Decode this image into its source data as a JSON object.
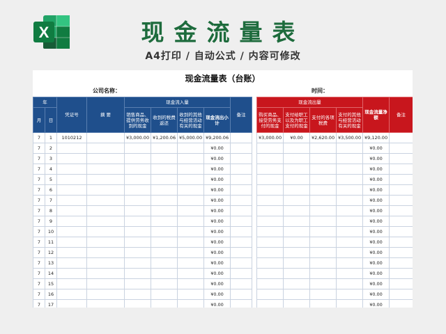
{
  "banner": {
    "logo_letter": "X",
    "title": "现金流量表",
    "subtitle": "A4打印 / 自动公式 / 内容可修改"
  },
  "sheet": {
    "title": "现金流量表（台账）",
    "company_label": "公司名称：",
    "time_label": "时间："
  },
  "headers": {
    "year": "年",
    "month": "月",
    "day": "日",
    "voucher": "凭证号",
    "summary": "摘    要",
    "inflow_group": "现金流入量",
    "inflow_cols": [
      "销售商品、提供劳务收到的现金",
      "收到的税费返还",
      "收到的其他与经营活动有关的现金",
      "现金流出小计"
    ],
    "remark": "备注",
    "outflow_group": "现金流出量",
    "outflow_cols": [
      "购买商品、接受劳务支付的现金",
      "支付给职工以及为职工支付的现金",
      "支付的各项税费",
      "支付的其他与经营活动有关的现金"
    ],
    "net_flow": "现金流量净额",
    "remark2": "备注"
  },
  "rows": [
    {
      "m": "7",
      "d": "1",
      "voucher": "1010212",
      "in1": "¥3,000.00",
      "in2": "¥1,200.06",
      "in3": "¥5,000.00",
      "in_sub": "¥9,200.06",
      "out1": "¥3,000.00",
      "out2": "¥0.00",
      "out3": "¥2,620.00",
      "out4": "¥3,500.00",
      "net": "¥9,120.00"
    },
    {
      "m": "7",
      "d": "2",
      "voucher": "",
      "in1": "",
      "in2": "",
      "in3": "",
      "in_sub": "¥0.00",
      "out1": "",
      "out2": "",
      "out3": "",
      "out4": "",
      "net": "¥0.00"
    },
    {
      "m": "7",
      "d": "3",
      "voucher": "",
      "in1": "",
      "in2": "",
      "in3": "",
      "in_sub": "¥0.00",
      "out1": "",
      "out2": "",
      "out3": "",
      "out4": "",
      "net": "¥0.00"
    },
    {
      "m": "7",
      "d": "4",
      "voucher": "",
      "in1": "",
      "in2": "",
      "in3": "",
      "in_sub": "¥0.00",
      "out1": "",
      "out2": "",
      "out3": "",
      "out4": "",
      "net": "¥0.00"
    },
    {
      "m": "7",
      "d": "5",
      "voucher": "",
      "in1": "",
      "in2": "",
      "in3": "",
      "in_sub": "¥0.00",
      "out1": "",
      "out2": "",
      "out3": "",
      "out4": "",
      "net": "¥0.00"
    },
    {
      "m": "7",
      "d": "6",
      "voucher": "",
      "in1": "",
      "in2": "",
      "in3": "",
      "in_sub": "¥0.00",
      "out1": "",
      "out2": "",
      "out3": "",
      "out4": "",
      "net": "¥0.00"
    },
    {
      "m": "7",
      "d": "7",
      "voucher": "",
      "in1": "",
      "in2": "",
      "in3": "",
      "in_sub": "¥0.00",
      "out1": "",
      "out2": "",
      "out3": "",
      "out4": "",
      "net": "¥0.00"
    },
    {
      "m": "7",
      "d": "8",
      "voucher": "",
      "in1": "",
      "in2": "",
      "in3": "",
      "in_sub": "¥0.00",
      "out1": "",
      "out2": "",
      "out3": "",
      "out4": "",
      "net": "¥0.00"
    },
    {
      "m": "7",
      "d": "9",
      "voucher": "",
      "in1": "",
      "in2": "",
      "in3": "",
      "in_sub": "¥0.00",
      "out1": "",
      "out2": "",
      "out3": "",
      "out4": "",
      "net": "¥0.00"
    },
    {
      "m": "7",
      "d": "10",
      "voucher": "",
      "in1": "",
      "in2": "",
      "in3": "",
      "in_sub": "¥0.00",
      "out1": "",
      "out2": "",
      "out3": "",
      "out4": "",
      "net": "¥0.00"
    },
    {
      "m": "7",
      "d": "11",
      "voucher": "",
      "in1": "",
      "in2": "",
      "in3": "",
      "in_sub": "¥0.00",
      "out1": "",
      "out2": "",
      "out3": "",
      "out4": "",
      "net": "¥0.00"
    },
    {
      "m": "7",
      "d": "12",
      "voucher": "",
      "in1": "",
      "in2": "",
      "in3": "",
      "in_sub": "¥0.00",
      "out1": "",
      "out2": "",
      "out3": "",
      "out4": "",
      "net": "¥0.00"
    },
    {
      "m": "7",
      "d": "13",
      "voucher": "",
      "in1": "",
      "in2": "",
      "in3": "",
      "in_sub": "¥0.00",
      "out1": "",
      "out2": "",
      "out3": "",
      "out4": "",
      "net": "¥0.00"
    },
    {
      "m": "7",
      "d": "14",
      "voucher": "",
      "in1": "",
      "in2": "",
      "in3": "",
      "in_sub": "¥0.00",
      "out1": "",
      "out2": "",
      "out3": "",
      "out4": "",
      "net": "¥0.00"
    },
    {
      "m": "7",
      "d": "15",
      "voucher": "",
      "in1": "",
      "in2": "",
      "in3": "",
      "in_sub": "¥0.00",
      "out1": "",
      "out2": "",
      "out3": "",
      "out4": "",
      "net": "¥0.00"
    },
    {
      "m": "7",
      "d": "16",
      "voucher": "",
      "in1": "",
      "in2": "",
      "in3": "",
      "in_sub": "¥0.00",
      "out1": "",
      "out2": "",
      "out3": "",
      "out4": "",
      "net": "¥0.00"
    },
    {
      "m": "7",
      "d": "17",
      "voucher": "",
      "in1": "",
      "in2": "",
      "in3": "",
      "in_sub": "¥0.00",
      "out1": "",
      "out2": "",
      "out3": "",
      "out4": "",
      "net": "¥0.00"
    }
  ],
  "colors": {
    "brand_green": "#1d6b3c",
    "header_blue": "#1f4f8c",
    "header_red": "#c8161d"
  },
  "icons": {
    "logo": "excel-logo-icon"
  }
}
